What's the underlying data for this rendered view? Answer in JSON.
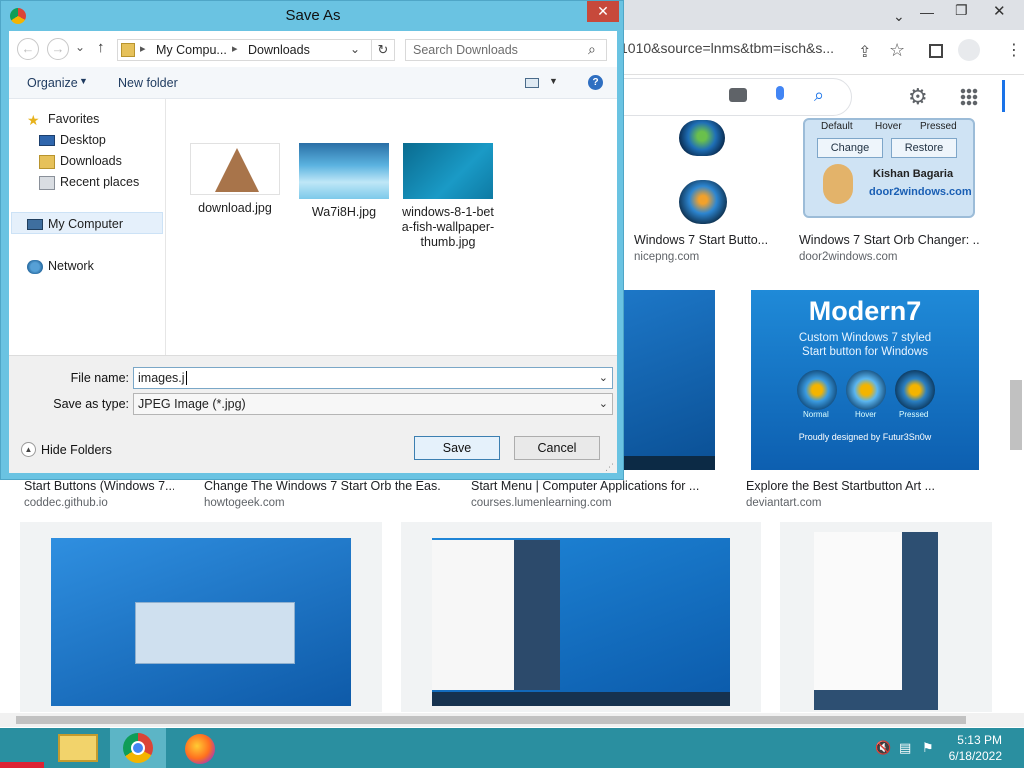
{
  "dialog": {
    "title": "Save As",
    "close_glyph": "✕",
    "breadcrumb": [
      "My Compu...",
      "Downloads"
    ],
    "search_placeholder": "Search Downloads",
    "toolbar": {
      "organize": "Organize",
      "new_folder": "New folder"
    },
    "tree": [
      {
        "label": "Favorites",
        "icon": "star-icon"
      },
      {
        "label": "Desktop",
        "icon": "desktop-icon"
      },
      {
        "label": "Downloads",
        "icon": "downloads-folder-icon"
      },
      {
        "label": "Recent places",
        "icon": "recent-places-icon"
      },
      {
        "label": "My Computer",
        "icon": "computer-icon"
      },
      {
        "label": "Network",
        "icon": "network-icon"
      }
    ],
    "files": [
      {
        "name": "download.jpg"
      },
      {
        "name": "Wa7i8H.jpg"
      },
      {
        "name": "windows-8-1-bet a-fish-wallpaper-thumb.jpg"
      }
    ],
    "file_name_label": "File name:",
    "file_name_value": "images.j",
    "save_type_label": "Save as type:",
    "save_type_value": "JPEG Image (*.jpg)",
    "hide_folders": "Hide Folders",
    "save_button": "Save",
    "cancel_button": "Cancel"
  },
  "browser": {
    "url": "1010&source=lnms&tbm=isch&s...",
    "results": [
      {
        "title": "Windows 7 Start Butto...",
        "source": "nicepng.com"
      },
      {
        "title": "Windows 7 Start Orb Changer: ...",
        "source": "door2windows.com"
      },
      {
        "title": "Start Buttons (Windows 7...",
        "source": "coddec.github.io"
      },
      {
        "title": "Change The Windows 7 Start Orb the Eas...",
        "source": "howtogeek.com"
      },
      {
        "title": "Start Menu | Computer Applications for ...",
        "source": "courses.lumenlearning.com"
      },
      {
        "title": "Explore the Best Startbutton Art ...",
        "source": "deviantart.com"
      }
    ],
    "orb_changer_labels": {
      "default": "Default",
      "hover": "Hover",
      "pressed": "Pressed",
      "change": "Change",
      "restore": "Restore",
      "author": "Kishan Bagaria",
      "site": "door2windows.com"
    },
    "modern7": {
      "title": "Modern7",
      "line1": "Custom Windows 7 styled",
      "line2": "Start button for Windows",
      "normal": "Normal",
      "hover": "Hover",
      "pressed": "Pressed",
      "credit": "Proudly designed by Futur3Sn0w"
    }
  },
  "taskbar": {
    "time": "5:13 PM",
    "date": "6/18/2022"
  }
}
